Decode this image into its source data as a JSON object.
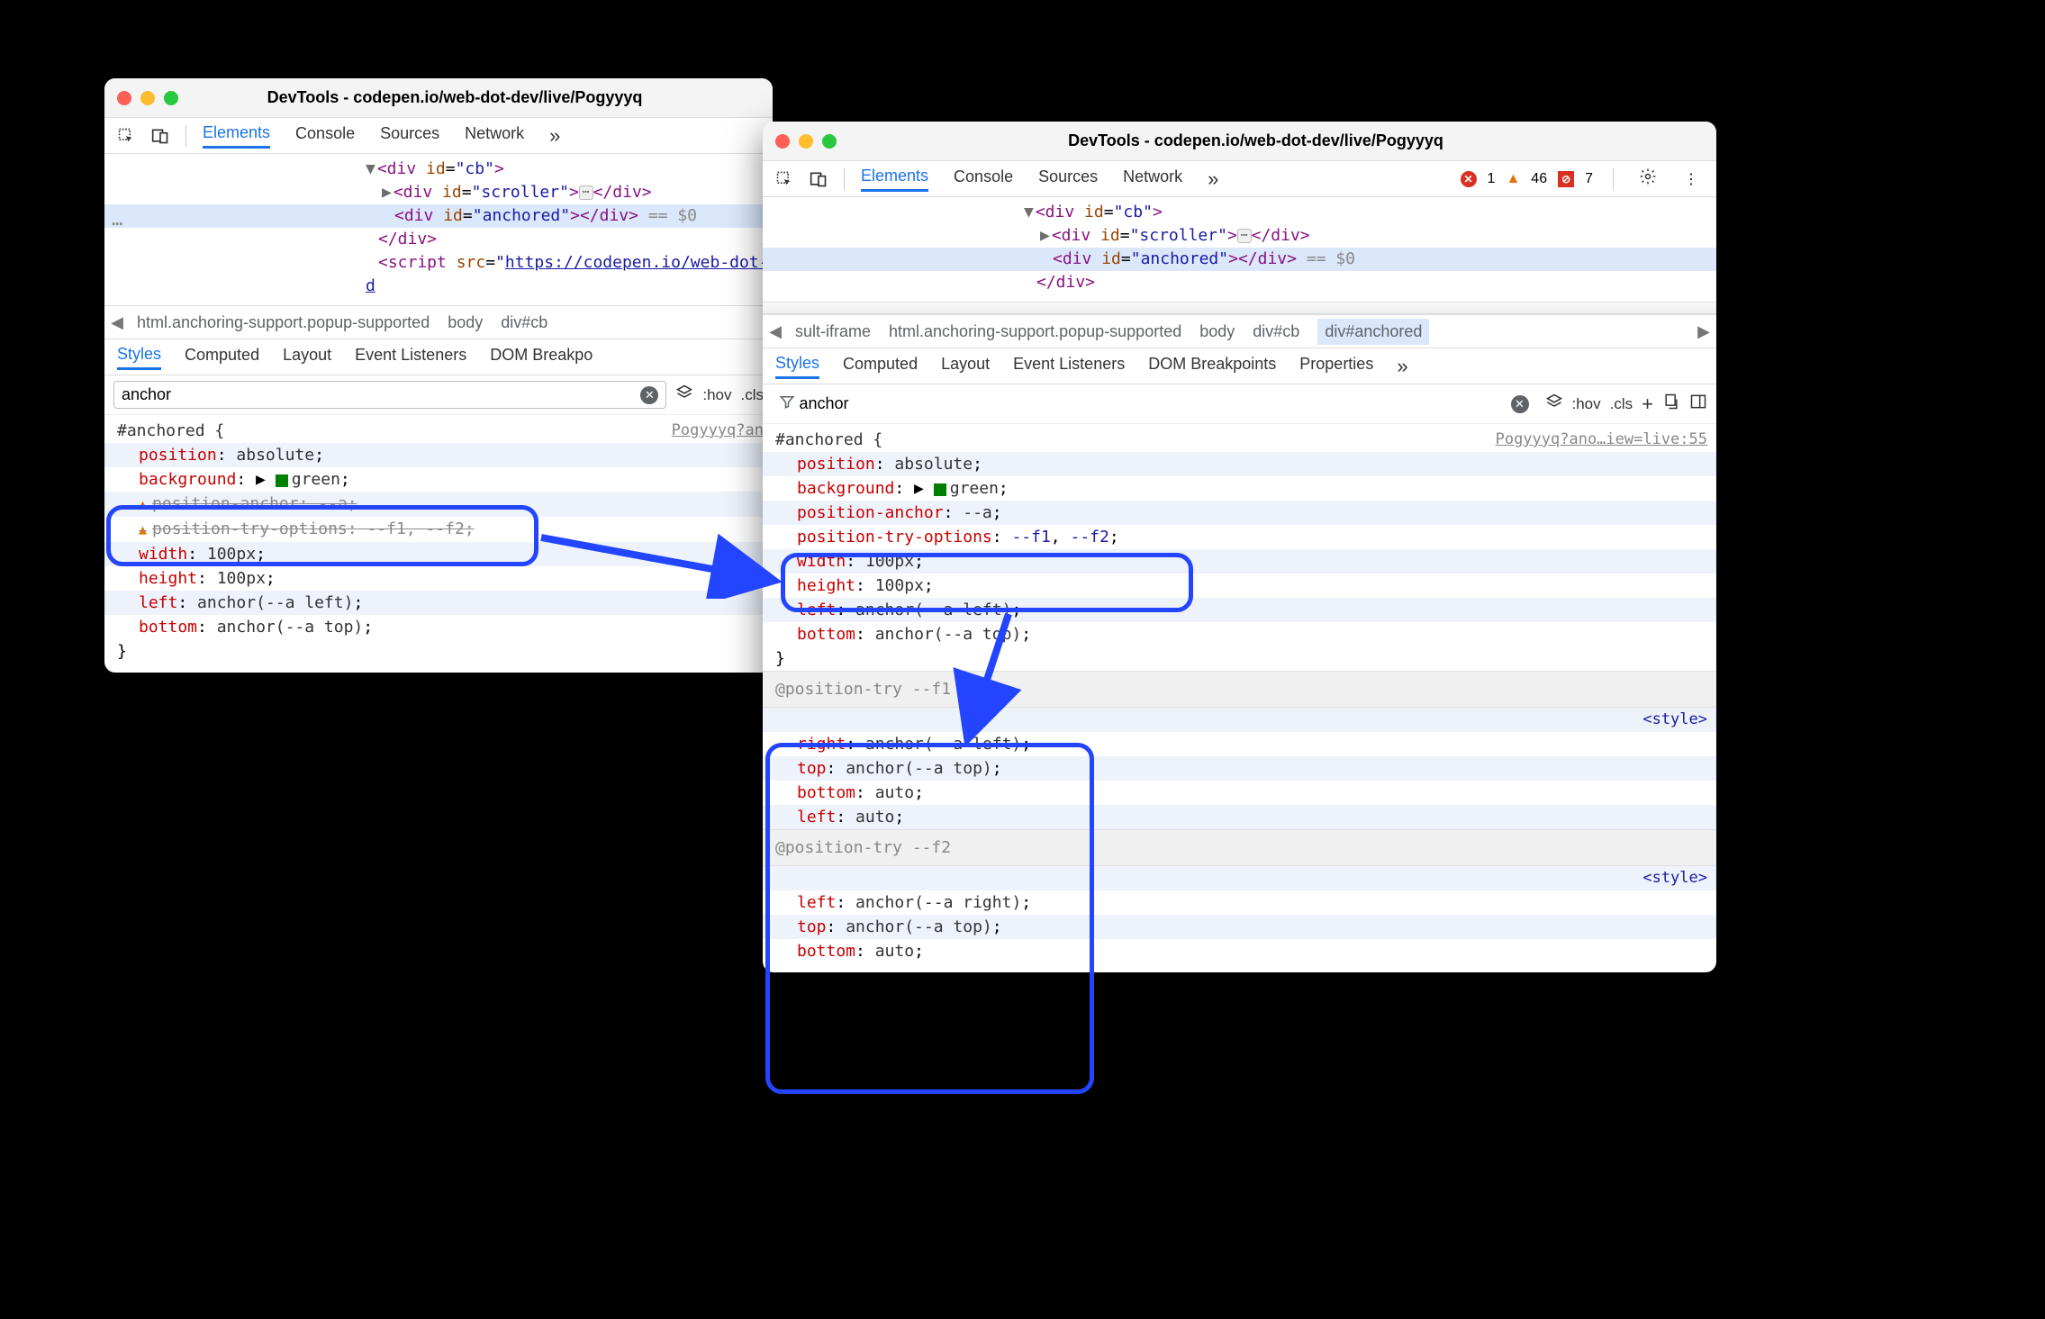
{
  "title": "DevTools - codepen.io/web-dot-dev/live/Pogyyyq",
  "tabs": {
    "elements": "Elements",
    "console": "Console",
    "sources": "Sources",
    "network": "Network"
  },
  "issues": {
    "errors": "1",
    "warnings": "46",
    "info": "7"
  },
  "e": {
    "cb_open": "<div id=\"cb\">",
    "scroller": "<div id=\"scroller\">",
    "scroller_close": "</div>",
    "anchored": "<div id=\"anchored\">",
    "anchored_close": "</div>",
    "eqdollar": "== $0",
    "div_close": "</div>",
    "script_open": "<script src=\"",
    "script_url": "https://codepen.io/web-dot-d",
    "script_q": "…"
  },
  "bc1": {
    "items": [
      "html.anchoring-support.popup-supported",
      "body",
      "div#cb"
    ]
  },
  "bc2": {
    "trunc": "sult-iframe",
    "items": [
      "html.anchoring-support.popup-supported",
      "body",
      "div#cb",
      "div#anchored"
    ]
  },
  "subtabs": {
    "styles": "Styles",
    "computed": "Computed",
    "layout": "Layout",
    "el": "Event Listeners",
    "dbp": "DOM Breakpoints",
    "dbp_s": "DOM Breakpo",
    "props": "Properties"
  },
  "filter": {
    "value": "anchor",
    "hov": ":hov",
    "cls": ".cls"
  },
  "link1": "Pogyyyq?an",
  "link2": "Pogyyyq?ano…iew=live:55",
  "styletag": "<style>",
  "css": {
    "selector": "#anchored {",
    "position": "position",
    "position_v": "absolute",
    "background": "background",
    "green": "green",
    "panchor": "position-anchor",
    "panchor_v": "--a",
    "ptry": "position-try-options",
    "ptry_v": "--f1, --f2",
    "width": "width",
    "width_v": "100px",
    "height": "height",
    "height_v": "100px",
    "left": "left",
    "left_v": "anchor(--a left)",
    "bottom": "bottom",
    "bottom_v": "anchor(--a top)",
    "close": "}",
    "ptf1": "@position-try --f1",
    "right": "right",
    "right_v": "anchor(--a left)",
    "top": "top",
    "top_v": "anchor(--a top)",
    "auto": "auto",
    "ptf2": "@position-try --f2",
    "left2_v": "anchor(--a right)"
  },
  "plus": "+"
}
